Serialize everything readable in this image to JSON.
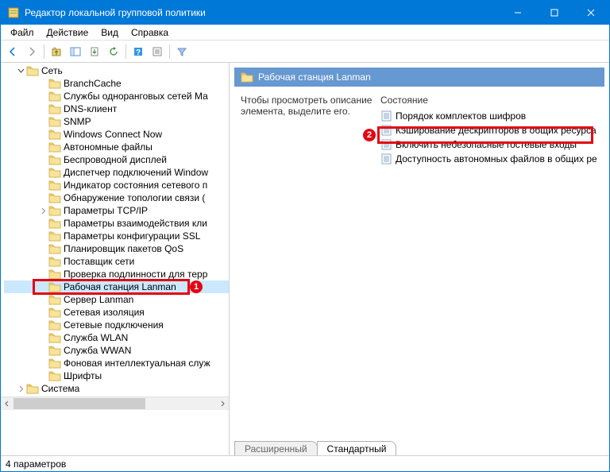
{
  "window": {
    "title": "Редактор локальной групповой политики"
  },
  "menu": {
    "file": "Файл",
    "action": "Действие",
    "view": "Вид",
    "help": "Справка"
  },
  "tree": {
    "root": "Сеть",
    "items": [
      "BranchCache",
      "Службы одноранговых сетей Ма",
      "DNS-клиент",
      "SNMP",
      "Windows Connect Now",
      "Автономные файлы",
      "Беспроводной дисплей",
      "Диспетчер подключений Window",
      "Индикатор состояния сетевого п",
      "Обнаружение топологии связи (",
      "Параметры TCP/IP",
      "Параметры взаимодействия кли",
      "Параметры конфигурации SSL",
      "Планировщик пакетов QoS",
      "Поставщик сети",
      "Проверка подлинности для терр",
      "Рабочая станция Lanman",
      "Сервер Lanman",
      "Сетевая изоляция",
      "Сетевые подключения",
      "Служба WLAN",
      "Служба WWAN",
      "Фоновая интеллектуальная служ",
      "Шрифты"
    ],
    "sibling": "Система"
  },
  "right": {
    "header": "Рабочая станция Lanman",
    "desc": "Чтобы просмотреть описание элемента, выделите его.",
    "col": "Состояние",
    "items": [
      "Порядок комплектов шифров",
      "Кэширование дескрипторов в общих ресурса",
      "Включить небезопасные гостевые входы",
      "Доступность автономных файлов в общих ре"
    ]
  },
  "tabs": {
    "extended": "Расширенный",
    "standard": "Стандартный"
  },
  "status": "4 параметров",
  "badges": {
    "one": "1",
    "two": "2"
  }
}
